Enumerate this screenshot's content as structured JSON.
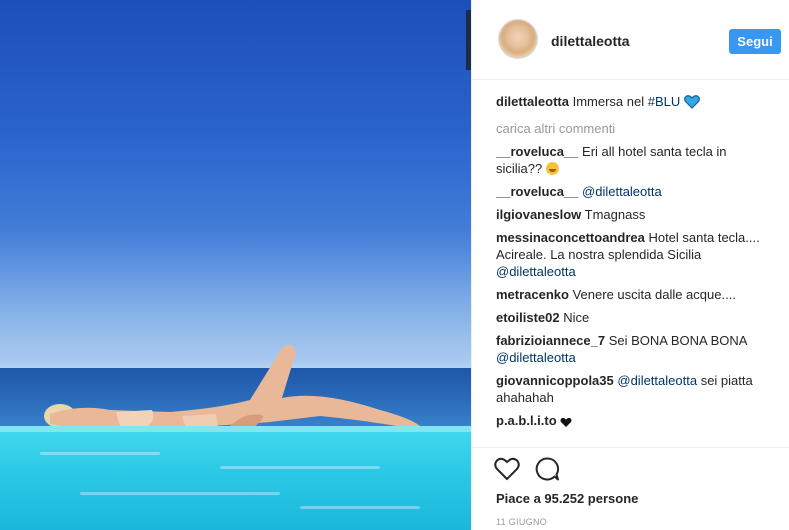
{
  "post": {
    "username": "dilettaleotta",
    "follow_label": "Segui"
  },
  "caption": {
    "user": "dilettaleotta",
    "text": "Immersa nel ",
    "hashtag": "#BLU"
  },
  "load_more": "carica altri commenti",
  "comments": [
    {
      "user": "__roveluca__",
      "text": " Eri all hotel santa tecla in sicilia??"
    },
    {
      "user": "__roveluca__",
      "text": " ",
      "mention": "@dilettaleotta"
    },
    {
      "user": "ilgiovaneslow",
      "text": " Tmagnass"
    },
    {
      "user": "messinaconcettoandrea",
      "text": " Hotel santa tecla.... Acireale. La nostra splendida Sicilia ",
      "mention": "@dilettaleotta"
    },
    {
      "user": "metracenko",
      "text": " Venere uscita dalle acque...."
    },
    {
      "user": "etoiliste02",
      "text": " Nice"
    },
    {
      "user": "fabrizioiannece_7",
      "text": " Sei BONA BONA BONA ",
      "mention": "@dilettaleotta"
    },
    {
      "user": "giovannicoppola35",
      "mention": "@dilettaleotta",
      "text_after": " sei piatta ahahahah"
    },
    {
      "user": "p.a.b.l.i.to",
      "text": " "
    }
  ],
  "likes_text": "Piace a 95.252 persone",
  "date_text": "11 GIUGNO",
  "icons": {
    "heart_caption": "blue-heart-icon",
    "emoji": "grinning-sweat-emoji-icon",
    "heart_comment": "black-heart-icon",
    "like": "like-heart-icon",
    "comment": "comment-bubble-icon"
  },
  "colors": {
    "follow_button": "#3897f0",
    "mention": "#003569",
    "muted": "#999999",
    "heart_blue": "#33a7e8"
  }
}
